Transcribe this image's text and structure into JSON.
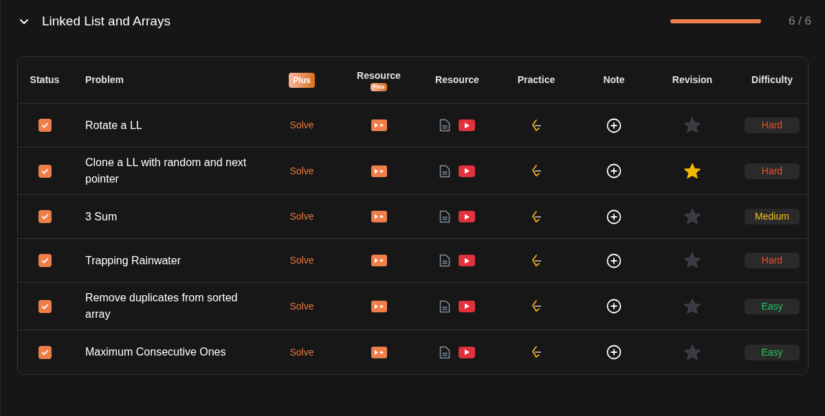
{
  "section": {
    "title": "Linked List and Arrays",
    "expanded": true,
    "progress": {
      "level": 1,
      "count": "6 / 6"
    }
  },
  "table": {
    "columns": [
      {
        "kind": "text",
        "label": "Status"
      },
      {
        "kind": "text",
        "label": "Problem"
      },
      {
        "kind": "plus",
        "badge": "Plus"
      },
      {
        "kind": "resource-plus",
        "label": "Resource",
        "badge": "Plus"
      },
      {
        "kind": "text",
        "label": "Resource"
      },
      {
        "kind": "text",
        "label": "Practice"
      },
      {
        "kind": "text",
        "label": "Note"
      },
      {
        "kind": "text",
        "label": "Revision"
      },
      {
        "kind": "text",
        "label": "Difficulty"
      }
    ],
    "rows": [
      {
        "checked": true,
        "problem": "Rotate a LL",
        "action": "Solve",
        "starred": false,
        "difficulty": {
          "kind": "hard",
          "label": "Hard"
        }
      },
      {
        "checked": true,
        "problem": "Clone a LL with random and next pointer",
        "action": "Solve",
        "starred": true,
        "difficulty": {
          "kind": "hard",
          "label": "Hard"
        }
      },
      {
        "checked": true,
        "problem": "3 Sum",
        "action": "Solve",
        "starred": false,
        "difficulty": {
          "kind": "medium",
          "label": "Medium"
        }
      },
      {
        "checked": true,
        "problem": "Trapping Rainwater",
        "action": "Solve",
        "starred": false,
        "difficulty": {
          "kind": "hard",
          "label": "Hard"
        }
      },
      {
        "checked": true,
        "problem": "Remove duplicates from sorted array",
        "action": "Solve",
        "starred": false,
        "difficulty": {
          "kind": "easy",
          "label": "Easy"
        }
      },
      {
        "checked": true,
        "problem": "Maximum Consecutive Ones",
        "action": "Solve",
        "starred": false,
        "difficulty": {
          "kind": "easy",
          "label": "Easy"
        }
      }
    ]
  }
}
